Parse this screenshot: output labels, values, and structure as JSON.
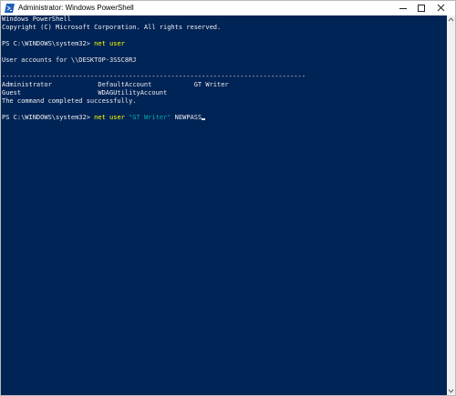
{
  "window": {
    "title": "Administrator: Windows PowerShell",
    "icon": "powershell-icon",
    "controls": [
      "minimize-icon",
      "maximize-icon",
      "close-icon"
    ]
  },
  "colors": {
    "console_background": "#012456",
    "console_text": "#eeedf0",
    "command": "#ffff00",
    "string": "#00aaaa"
  },
  "console": {
    "header_line1": "Windows PowerShell",
    "header_line2": "Copyright (C) Microsoft Corporation. All rights reserved.",
    "prompt1": "PS C:\\WINDOWS\\system32> ",
    "command1": "net user",
    "accounts_for": "User accounts for \\\\DESKTOP-3SSC8RJ",
    "separator": "-------------------------------------------------------------------------------",
    "accounts_row1": "Administrator            DefaultAccount           GT Writer",
    "accounts_row2": "Guest                    WDAGUtilityAccount",
    "completed": "The command completed successfully.",
    "prompt2": "PS C:\\WINDOWS\\system32> ",
    "command2": "net user",
    "command2_arg": "\"GT Writer\"",
    "command2_pass": "NEWPASS"
  }
}
